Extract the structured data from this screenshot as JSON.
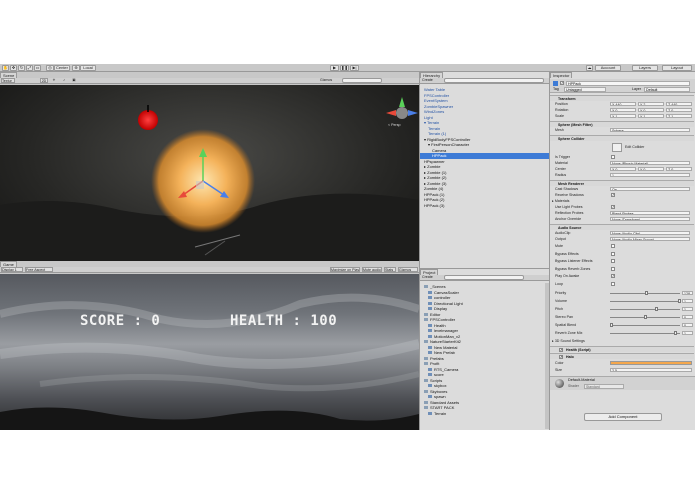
{
  "toolbar": {
    "pivot_label": "Center",
    "space_label": "Local",
    "account_label": "Account",
    "layers_label": "Layers",
    "layout_label": "Layout"
  },
  "scene": {
    "tab": "Scene",
    "shading": "Textur",
    "mode_2d": "2D",
    "gizmos": "Gizmos",
    "persp": "< Persp"
  },
  "game": {
    "tab": "Game",
    "display": "Display 1",
    "aspect": "Free Aspect",
    "maximize": "Maximize on Play",
    "mute": "Mute audio",
    "stats": "Stats",
    "gizmos": "Gizmos",
    "score": "SCORE : 0",
    "health": "HEALTH : 100"
  },
  "hierarchy": {
    "tab": "Hierarchy",
    "create": "Create",
    "items": [
      "Water Table",
      "FPSController",
      "EventSystem",
      "ZombieSpawner",
      "WindZones",
      "Light",
      "Terrain",
      "Terrain",
      "Terrain (1)",
      "RigidBodyFPSController",
      "FirstPersonCharacter",
      "Camera",
      "HPPack",
      "HPspawner",
      "Zombie",
      "Zombie (1)",
      "Zombie (2)",
      "Zombie (3)",
      "Zombie (4)",
      "HPPack (1)",
      "HPPack (2)",
      "HPPack (3)"
    ],
    "selected_index": 12
  },
  "project": {
    "tab": "Project",
    "create": "Create",
    "items": [
      "_Scenes",
      "CanvasScaler",
      "controller",
      "Directional Light",
      "Display",
      "Editor",
      "FPSController",
      "Health",
      "levelmanager",
      "MotionMan_v2",
      "NatureStarterKit2",
      "New Material",
      "New Prefab",
      "Prefabs",
      "Profit",
      "RTS_Camera",
      "score",
      "Scripts",
      "skybox",
      "Skyboxes",
      "spawn",
      "Standard Assets",
      "START PACK",
      "Terrain"
    ]
  },
  "inspector": {
    "tab": "Inspector",
    "object_name": "HPPack",
    "tag_label": "Tag",
    "tag": "Untagged",
    "layer_label": "Layer",
    "layer": "Default",
    "transform": {
      "header": "Transform",
      "position_label": "Position",
      "position": [
        "X 440",
        "Y 2",
        "Z 440"
      ],
      "rotation_label": "Rotation",
      "rotation": [
        "X 0",
        "Y 0",
        "Z 0"
      ],
      "scale_label": "Scale",
      "scale": [
        "X 1",
        "Y 1",
        "Z 1"
      ]
    },
    "mesh_filter": {
      "header": "Sphere (Mesh Filter)",
      "mesh_label": "Mesh",
      "mesh": "Sphere"
    },
    "sphere_collider": {
      "header": "Sphere Collider",
      "edit_label": "Edit Collider",
      "trigger_label": "Is Trigger",
      "material_label": "Material",
      "material": "None (Physic Material)",
      "center_label": "Center",
      "center": [
        "X 0",
        "Y 0",
        "Z 0"
      ],
      "radius_label": "Radius",
      "radius": "1"
    },
    "mesh_renderer": {
      "header": "Mesh Renderer",
      "cast_label": "Cast Shadows",
      "cast": "On",
      "receive_label": "Receive Shadows",
      "materials_label": "Materials",
      "probes_label": "Use Light Probes",
      "reflection_label": "Reflection Probes",
      "reflection": "Blend Probes",
      "anchor_label": "Anchor Override",
      "anchor": "None (Transform)"
    },
    "audio_source": {
      "header": "Audio Source",
      "clip_label": "AudioClip",
      "clip": "None (Audio Clip)",
      "output_label": "Output",
      "output": "None (Audio Mixer Group)",
      "rows": [
        "Mute",
        "Bypass Effects",
        "Bypass Listener Effects",
        "Bypass Reverb Zones",
        "Play On Awake",
        "Loop"
      ],
      "priority_label": "Priority",
      "priority": "128",
      "volume_label": "Volume",
      "volume": "1",
      "pitch_label": "Pitch",
      "pitch": "1",
      "stereo_label": "Stereo Pan",
      "stereo": "0",
      "spatial_label": "Spatial Blend",
      "spatial": "0",
      "reverb_label": "Reverb Zone Mix",
      "reverb": "1",
      "settings_label": "3D Sound Settings"
    },
    "health_script": {
      "header": "Health (Script)"
    },
    "halo": {
      "header": "Halo",
      "color_label": "Color",
      "size_label": "Size",
      "size": "2.5"
    },
    "material": {
      "name": "Default-Material",
      "shader_label": "Shader",
      "shader": "Standard"
    },
    "add_component": "Add Component"
  },
  "colors": {
    "halo_color": "#f4a74d",
    "selection": "#3d7bd6"
  }
}
